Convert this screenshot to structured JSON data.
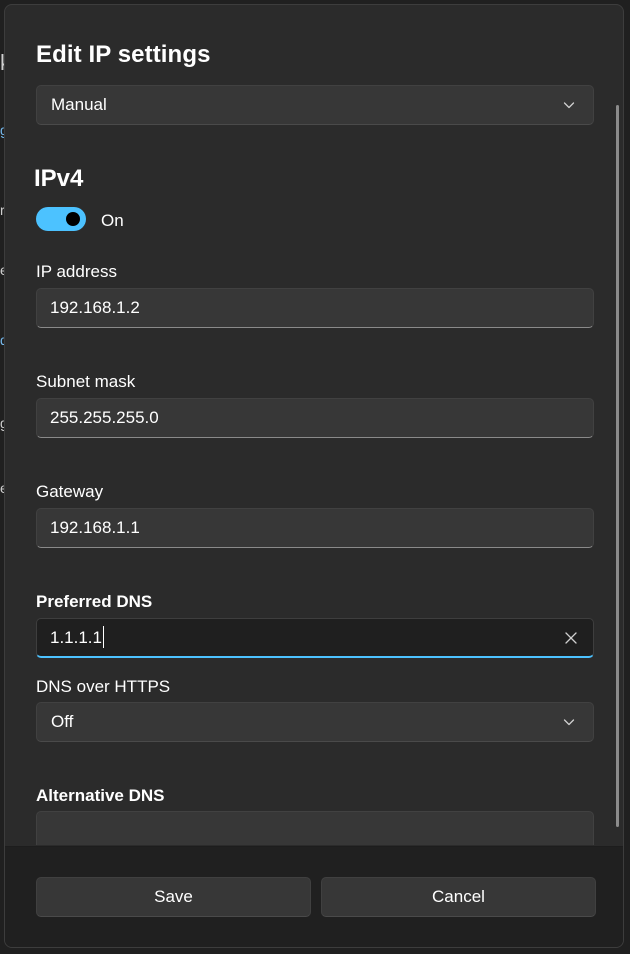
{
  "dialog": {
    "title": "Edit IP settings",
    "mode_select": {
      "value": "Manual",
      "icon": "chevron-down-icon"
    }
  },
  "ipv4": {
    "heading": "IPv4",
    "toggle": {
      "state": "On",
      "on": true,
      "accent": "#4cc2ff"
    },
    "ip_address": {
      "label": "IP address",
      "value": "192.168.1.2"
    },
    "subnet_mask": {
      "label": "Subnet mask",
      "value": "255.255.255.0"
    },
    "gateway": {
      "label": "Gateway",
      "value": "192.168.1.1"
    },
    "preferred_dns": {
      "label": "Preferred DNS",
      "value": "1.1.1.1",
      "clear_icon": "close-icon"
    },
    "dns_over_https": {
      "label": "DNS over HTTPS",
      "value": "Off",
      "icon": "chevron-down-icon"
    },
    "alternative_dns": {
      "label": "Alternative DNS"
    }
  },
  "footer": {
    "save_label": "Save",
    "cancel_label": "Cancel"
  },
  "colors": {
    "accent": "#4cc2ff",
    "dialog_bg": "#2b2b2b",
    "control_bg": "#373737"
  }
}
